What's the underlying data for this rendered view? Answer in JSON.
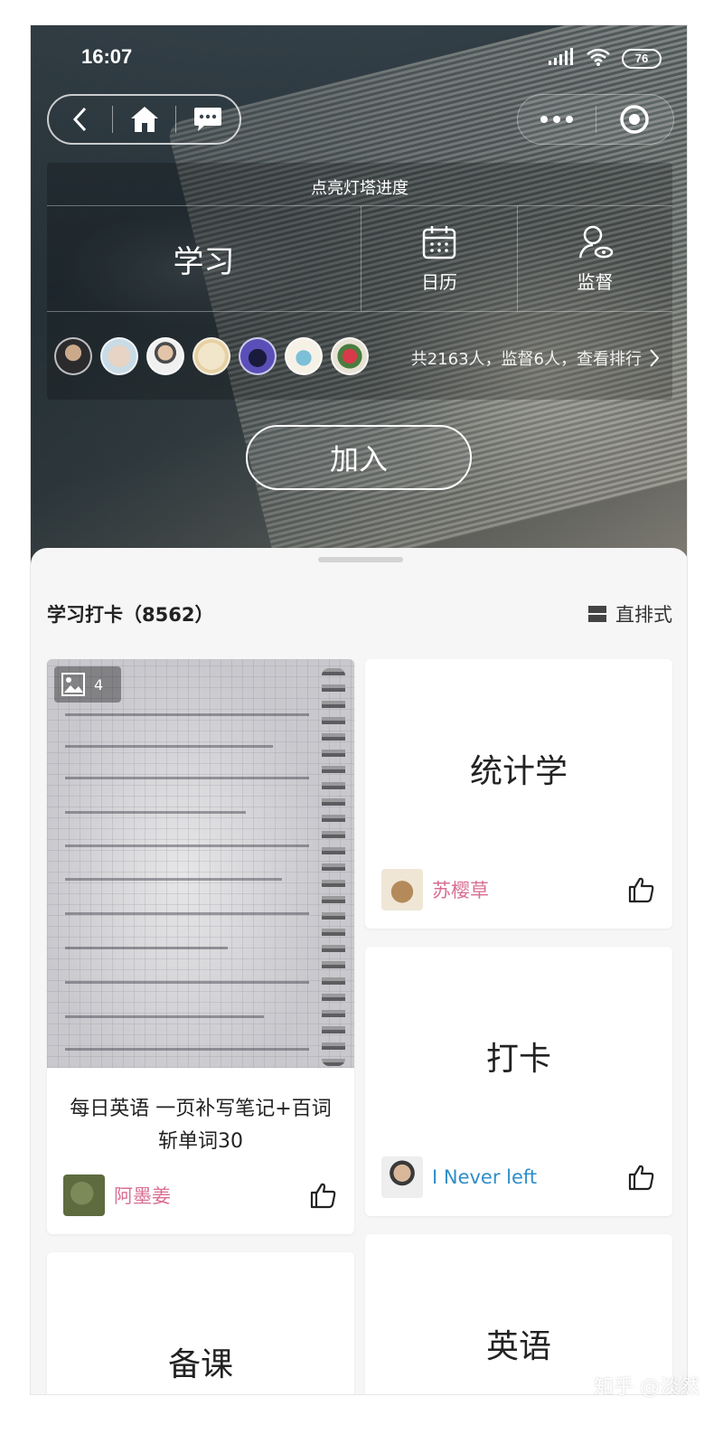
{
  "status_bar": {
    "time": "16:07",
    "battery": "76"
  },
  "panel": {
    "title": "点亮灯塔进度",
    "main_label": "学习",
    "calendar_label": "日历",
    "supervise_label": "监督",
    "members_text": "共2163人，监督6人，查看排行"
  },
  "join_label": "加入",
  "feed": {
    "title": "学习打卡（8562）",
    "layout_label": "直排式",
    "cards": [
      {
        "photo_count": "4",
        "description": "每日英语 一页补写笔记+百词斩单词30",
        "author": "阿墨姜"
      },
      {
        "title": "统计学",
        "author": "苏樱草"
      },
      {
        "title": "打卡",
        "author": "I Never left"
      },
      {
        "title": "备课"
      },
      {
        "title": "英语"
      }
    ]
  },
  "watermark": "知乎 @淡然",
  "colors": {
    "author_pink": "#d96e93",
    "author_blue": "#2f8ec9"
  }
}
